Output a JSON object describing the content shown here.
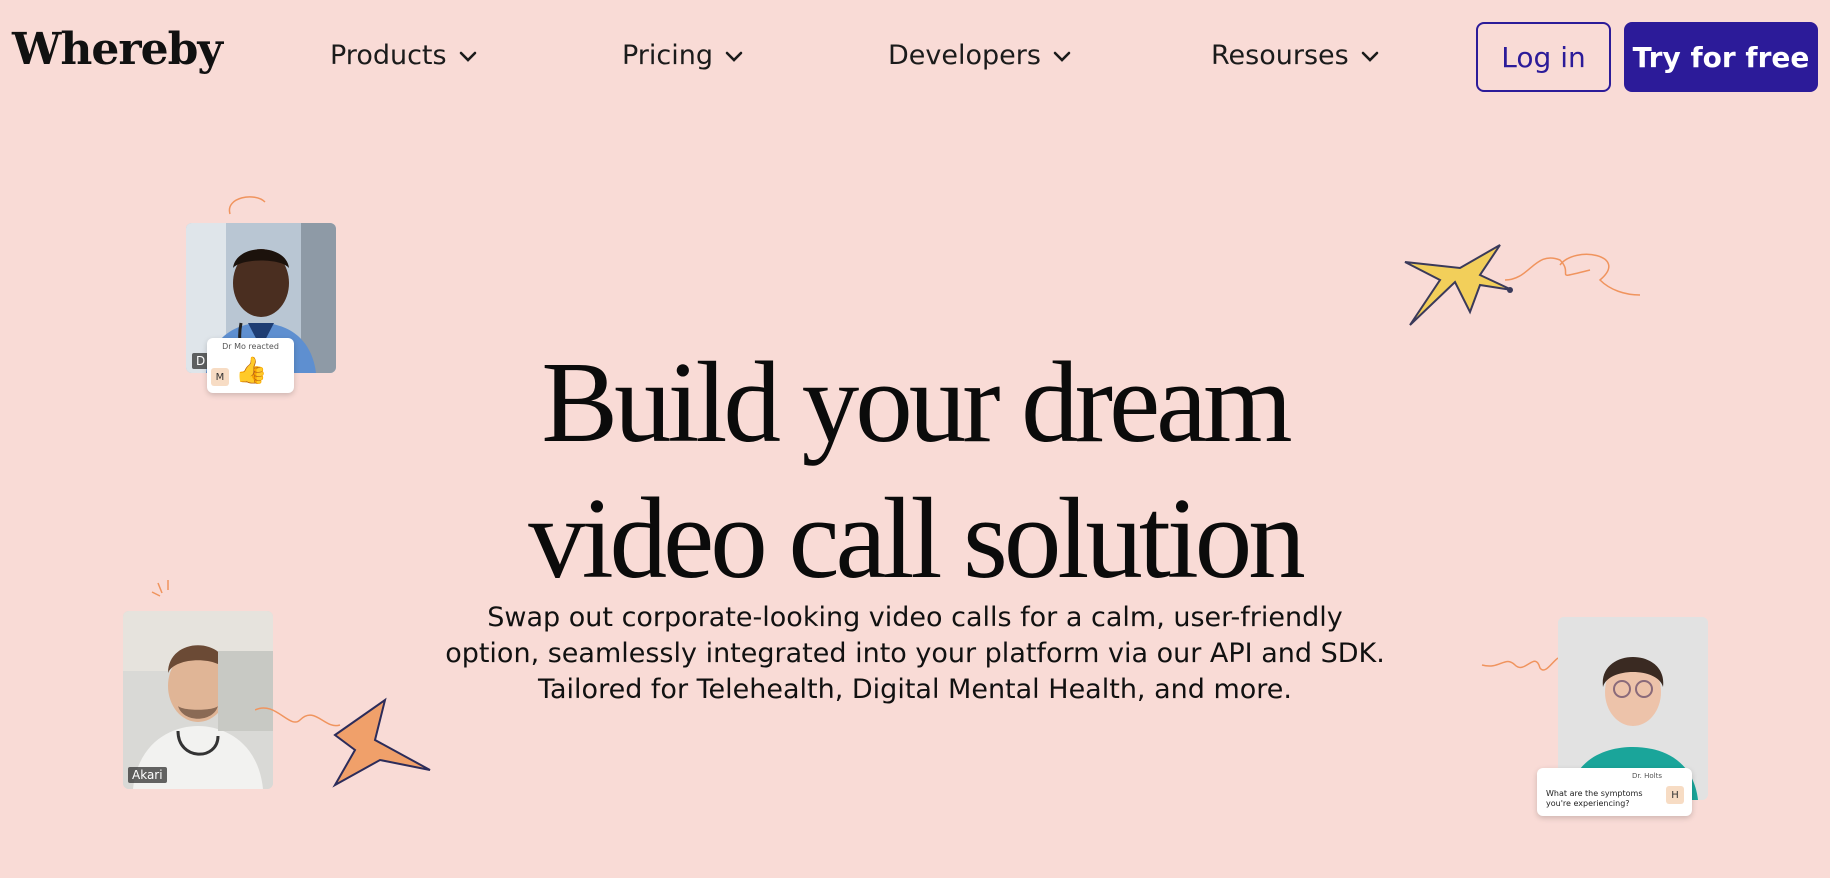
{
  "brand": {
    "name": "Whereby"
  },
  "nav": {
    "items": [
      {
        "label": "Products"
      },
      {
        "label": "Pricing"
      },
      {
        "label": "Developers"
      },
      {
        "label": "Resourses"
      }
    ],
    "login_label": "Log in",
    "try_label": "Try for free"
  },
  "hero": {
    "headline_line1": "Build your dream",
    "headline_line2": "video call solution",
    "subtitle": "Swap out corporate-looking video calls for a calm, user-friendly option, seamlessly integrated into your platform via our API and SDK. Tailored for Telehealth, Digital Mental Health, and more."
  },
  "cards": {
    "doctor_mo": {
      "name_tag": "D",
      "reaction_text": "Dr Mo reacted",
      "reaction_avatar": "M",
      "reaction_emoji": "👍"
    },
    "akari": {
      "name_tag": "Akari"
    },
    "dr_holts": {
      "chat_sender": "Dr. Holts",
      "chat_message": "What are the symptoms you're experiencing?",
      "chat_avatar": "H"
    }
  },
  "colors": {
    "background": "#f9dbd6",
    "accent": "#2c1b99",
    "airplane_yellow": "#f2cf5a",
    "airplane_orange": "#f0a06a",
    "doodle": "#f0945e"
  },
  "icons": {
    "nav_chevron": "chevron-down-icon",
    "airplane_top": "airplane-icon",
    "paper_plane": "paper-plane-icon",
    "reaction": "thumbs-up-icon"
  }
}
